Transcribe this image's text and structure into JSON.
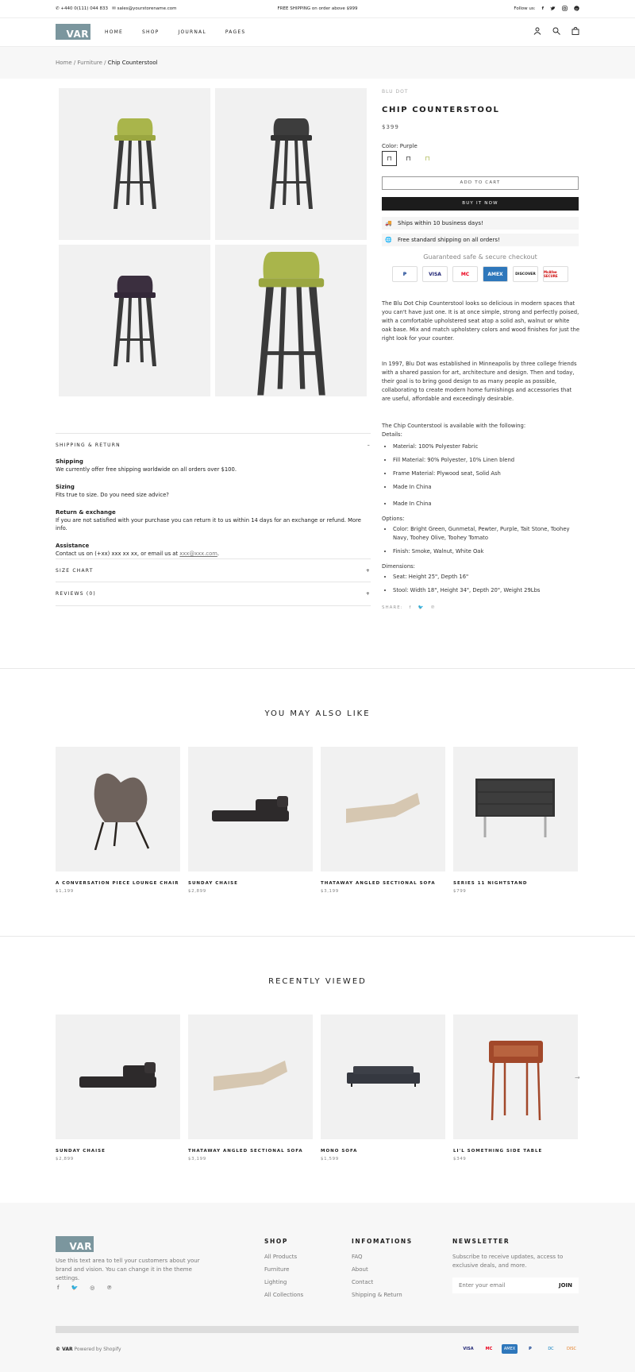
{
  "topbar": {
    "phone": "+440 0(111) 044 833",
    "email": "sales@yourstorename.com",
    "promo": "FREE SHIPPING on order above $999",
    "follow": "Follow us:"
  },
  "brand": {
    "logo": "VAR"
  },
  "nav": {
    "items": [
      "HOME",
      "SHOP",
      "JOURNAL",
      "PAGES"
    ]
  },
  "breadcrumb": {
    "home": "Home",
    "sep": "/",
    "cat": "Furniture",
    "current": "Chip Counterstool"
  },
  "product": {
    "vendor": "BLU DOT",
    "title": "CHIP COUNTERSTOOL",
    "price": "$399",
    "color_label": "Color: Purple",
    "add_to_cart": "ADD TO CART",
    "buy_now": "BUY IT NOW",
    "info1": "Ships within 10 business days!",
    "info2": "Free standard shipping on all orders!",
    "guarantee": "Guaranteed safe & secure checkout",
    "payments": [
      "P",
      "VISA",
      "MC",
      "AMEX",
      "DISCOVER",
      "McAfee SECURE"
    ],
    "desc1": "The Blu Dot Chip Counterstool looks so delicious in modern spaces that you can't have just one. It is at once simple, strong and perfectly poised, with a comfortable upholstered seat atop a solid ash, walnut or white oak base. Mix and match upholstery colors and wood finishes for just the right look for your counter.",
    "desc2": "In 1997, Blu Dot was established in Minneapolis by three college friends with a shared passion for art, architecture and design. Then and today, their goal is to bring good design to as many people as possible, collaborating to create modern home furnishings and accessories that are useful, affordable and exceedingly desirable.",
    "avail": "The Chip Counterstool is available with the following:",
    "details_label": "Details:",
    "details": [
      "Material: 100% Polyester Fabric",
      "Fill Material: 90% Polyester, 10% Linen blend",
      "Frame Material: Plywood seat, Solid Ash",
      "Made In China"
    ],
    "made2": "Made In China",
    "options_label": "Options:",
    "options": [
      "Color: Bright Green, Gunmetal, Pewter, Purple, Tait Stone, Toohey Navy, Toohey Olive, Toohey Tomato",
      "Finish: Smoke, Walnut, White Oak"
    ],
    "dims_label": "Dimensions:",
    "dims": [
      "Seat: Height 25\", Depth 16\"",
      "Stool: Width 18\", Height 34\", Depth 20\", Weight 29Lbs"
    ],
    "share": "SHARE:"
  },
  "accordion": {
    "ship_title": "SHIPPING & RETURN",
    "size_title": "SIZE CHART",
    "reviews_title": "REVIEWS (0)",
    "shipping_h": "Shipping",
    "shipping_t": "We currently offer free shipping worldwide on all orders over $100.",
    "sizing_h": "Sizing",
    "sizing_t": "Fits true to size. Do you need size advice?",
    "return_h": "Return & exchange",
    "return_t": "If you are not satisfied with your purchase you can return it to us within 14 days for an exchange or refund. More info.",
    "assist_h": "Assistance",
    "assist_t": "Contact us on (+xx) xxx xx xx, or email us at ",
    "assist_mail": "xxx@xxx.com",
    "assist_end": "."
  },
  "also": {
    "title": "YOU MAY ALSO LIKE",
    "items": [
      {
        "name": "A CONVERSATION PIECE LOUNGE CHAIR",
        "price": "$1,199"
      },
      {
        "name": "SUNDAY CHAISE",
        "price": "$2,899"
      },
      {
        "name": "THATAWAY ANGLED SECTIONAL SOFA",
        "price": "$3,199"
      },
      {
        "name": "SERIES 11 NIGHTSTAND",
        "price": "$799"
      }
    ]
  },
  "recent": {
    "title": "RECENTLY VIEWED",
    "items": [
      {
        "name": "SUNDAY CHAISE",
        "price": "$2,899"
      },
      {
        "name": "THATAWAY ANGLED SECTIONAL SOFA",
        "price": "$3,199"
      },
      {
        "name": "MONO SOFA",
        "price": "$1,599"
      },
      {
        "name": "LI'L SOMETHING SIDE TABLE",
        "price": "$349"
      }
    ]
  },
  "footer": {
    "about": "Use this text area to tell your customers about your brand and vision. You can change it in the theme settings.",
    "shop_h": "SHOP",
    "shop": [
      "All Products",
      "Furniture",
      "Lighting",
      "All Collections"
    ],
    "info_h": "INFOMATIONS",
    "info": [
      "FAQ",
      "About",
      "Contact",
      "Shipping & Return"
    ],
    "news_h": "NEWSLETTER",
    "news_t": "Subscribe to receive updates, access to exclusive deals, and more.",
    "email_ph": "Enter your email",
    "join": "JOIN",
    "copy_brand": "© VAR",
    "powered": "Powered by Shopify",
    "pay_icons": [
      "VISA",
      "MC",
      "AMEX",
      "P",
      "DC",
      "DISC"
    ]
  },
  "colors": {
    "accent": "#7b969e",
    "dark": "#1c1c1c",
    "seat_green": "#a9b54b",
    "seat_dark": "#3a3a3a",
    "seat_purple": "#3b2f3f"
  }
}
